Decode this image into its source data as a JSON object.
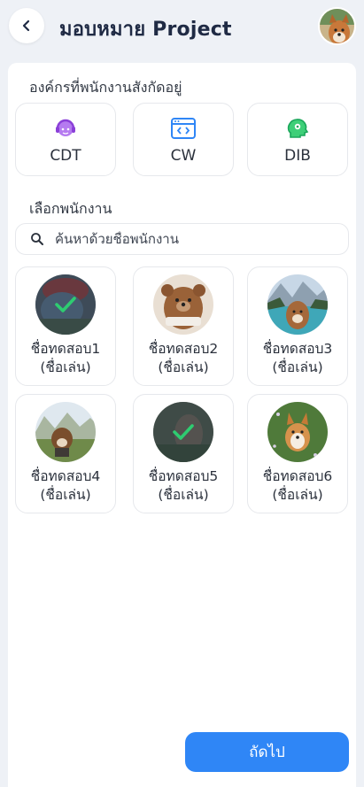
{
  "header": {
    "title": "มอบหมาย Project"
  },
  "org_section": {
    "label": "องค์กรที่พนักงานสังกัดอยู่",
    "orgs": [
      {
        "label": "CDT",
        "icon": "headset-user-icon",
        "color": "#a259e6"
      },
      {
        "label": "CW",
        "icon": "code-window-icon",
        "color": "#2f86f6"
      },
      {
        "label": "DIB",
        "icon": "head-gear-icon",
        "color": "#1aa65a"
      }
    ]
  },
  "employee_section": {
    "label": "เลือกพนักงาน",
    "search_placeholder": "ค้นหาด้วยชื่อพนักงาน",
    "employees": [
      {
        "name": "ชื่อทดสอบ1",
        "nickname": "(ชื่อเล่น)",
        "selected": true
      },
      {
        "name": "ชื่อทดสอบ2",
        "nickname": "(ชื่อเล่น)",
        "selected": false
      },
      {
        "name": "ชื่อทดสอบ3",
        "nickname": "(ชื่อเล่น)",
        "selected": false
      },
      {
        "name": "ชื่อทดสอบ4",
        "nickname": "(ชื่อเล่น)",
        "selected": false
      },
      {
        "name": "ชื่อทดสอบ5",
        "nickname": "(ชื่อเล่น)",
        "selected": true
      },
      {
        "name": "ชื่อทดสอบ6",
        "nickname": "(ชื่อเล่น)",
        "selected": false
      }
    ]
  },
  "footer": {
    "next_label": "ถัดไป"
  },
  "colors": {
    "accent": "#2f86f6",
    "check": "#2ecc71",
    "background": "#eef1f6"
  }
}
